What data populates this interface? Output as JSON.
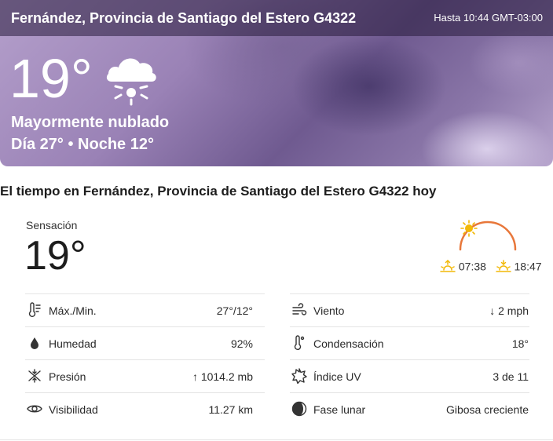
{
  "header": {
    "location": "Fernández, Provincia de Santiago del Estero G4322",
    "as_of": "Hasta 10:44 GMT-03:00"
  },
  "current": {
    "temperature": "19°",
    "icon": "cloud-sun-icon",
    "phrase": "Mayormente nublado",
    "day_night": "Día 27° • Noche 12°"
  },
  "today": {
    "title": "El tiempo en Fernández, Provincia de Santiago del Estero G4322 hoy",
    "feels_label": "Sensación",
    "feels_value": "19°",
    "sunrise": "07:38",
    "sunset": "18:47",
    "colors": {
      "arc": "#e8773a",
      "sun": "#f2b807"
    }
  },
  "details_left": [
    {
      "icon": "thermometer-icon",
      "label": "Máx./Min.",
      "value": "27°/12°"
    },
    {
      "icon": "humidity-drop-icon",
      "label": "Humedad",
      "value": "92%"
    },
    {
      "icon": "pressure-icon",
      "label": "Presión",
      "value": "↑ 1014.2 mb"
    },
    {
      "icon": "visibility-eye-icon",
      "label": "Visibilidad",
      "value": "11.27 km"
    }
  ],
  "details_right": [
    {
      "icon": "wind-icon",
      "label": "Viento",
      "value": "↓  2 mph"
    },
    {
      "icon": "dew-point-icon",
      "label": "Condensación",
      "value": "18°"
    },
    {
      "icon": "uv-index-icon",
      "label": "Índice UV",
      "value": "3 de 11"
    },
    {
      "icon": "moon-phase-icon",
      "label": "Fase lunar",
      "value": "Gibosa creciente"
    }
  ]
}
